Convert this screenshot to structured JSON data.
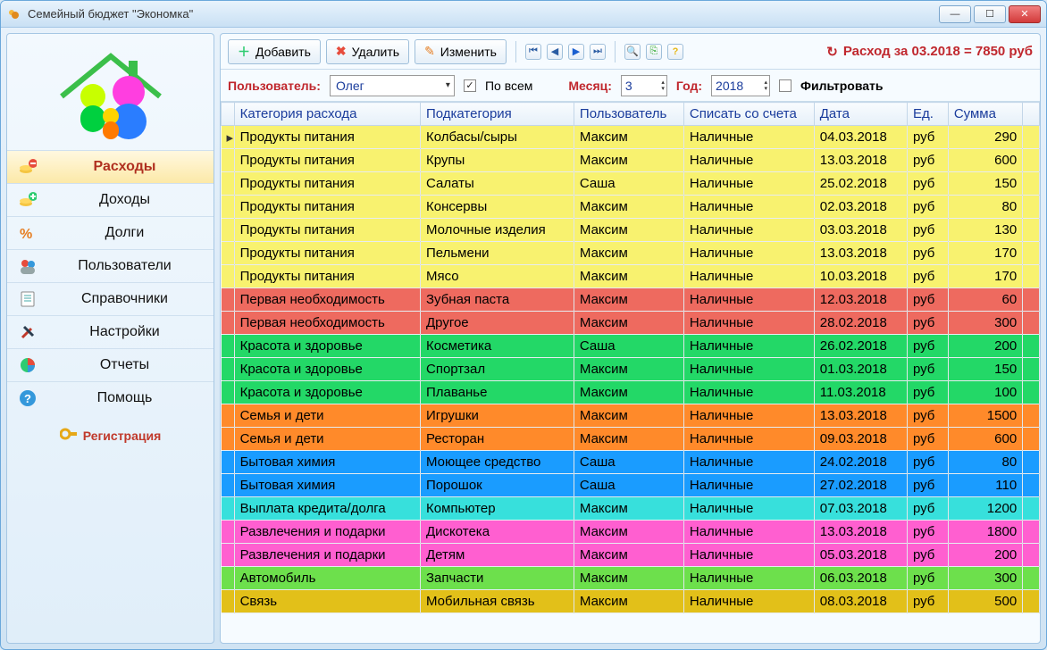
{
  "window": {
    "title": "Семейный бюджет \"Экономка\""
  },
  "sidebar": {
    "items": [
      {
        "label": "Расходы"
      },
      {
        "label": "Доходы"
      },
      {
        "label": "Долги"
      },
      {
        "label": "Пользователи"
      },
      {
        "label": "Справочники"
      },
      {
        "label": "Настройки"
      },
      {
        "label": "Отчеты"
      },
      {
        "label": "Помощь"
      }
    ],
    "register": "Регистрация"
  },
  "toolbar": {
    "add": "Добавить",
    "delete": "Удалить",
    "edit": "Изменить",
    "summary_prefix": "Расход за 03.2018 = ",
    "summary_value": "7850 руб"
  },
  "filters": {
    "user_label": "Пользователь:",
    "user_value": "Олег",
    "all_label": "По всем",
    "all_checked": true,
    "month_label": "Месяц:",
    "month_value": "3",
    "year_label": "Год:",
    "year_value": "2018",
    "filter_label": "Фильтровать",
    "filter_checked": false
  },
  "table": {
    "columns": [
      "Категория расхода",
      "Подкатегория",
      "Пользователь",
      "Списать со счета",
      "Дата",
      "Ед.",
      "Сумма"
    ],
    "rows": [
      {
        "color": "yellow",
        "marker": "▸",
        "cat": "Продукты питания",
        "sub": "Колбасы/сыры",
        "user": "Максим",
        "acct": "Наличные",
        "date": "04.03.2018",
        "unit": "руб",
        "sum": "290"
      },
      {
        "color": "yellow",
        "cat": "Продукты питания",
        "sub": "Крупы",
        "user": "Максим",
        "acct": "Наличные",
        "date": "13.03.2018",
        "unit": "руб",
        "sum": "600"
      },
      {
        "color": "yellow",
        "cat": "Продукты питания",
        "sub": "Салаты",
        "user": "Саша",
        "acct": "Наличные",
        "date": "25.02.2018",
        "unit": "руб",
        "sum": "150"
      },
      {
        "color": "yellow",
        "cat": "Продукты питания",
        "sub": "Консервы",
        "user": "Максим",
        "acct": "Наличные",
        "date": "02.03.2018",
        "unit": "руб",
        "sum": "80"
      },
      {
        "color": "yellow",
        "cat": "Продукты питания",
        "sub": "Молочные изделия",
        "user": "Максим",
        "acct": "Наличные",
        "date": "03.03.2018",
        "unit": "руб",
        "sum": "130"
      },
      {
        "color": "yellow",
        "cat": "Продукты питания",
        "sub": "Пельмени",
        "user": "Максим",
        "acct": "Наличные",
        "date": "13.03.2018",
        "unit": "руб",
        "sum": "170"
      },
      {
        "color": "yellow",
        "cat": "Продукты питания",
        "sub": "Мясо",
        "user": "Максим",
        "acct": "Наличные",
        "date": "10.03.2018",
        "unit": "руб",
        "sum": "170"
      },
      {
        "color": "red",
        "cat": "Первая необходимость",
        "sub": "Зубная паста",
        "user": "Максим",
        "acct": "Наличные",
        "date": "12.03.2018",
        "unit": "руб",
        "sum": "60"
      },
      {
        "color": "red",
        "cat": "Первая необходимость",
        "sub": "Другое",
        "user": "Максим",
        "acct": "Наличные",
        "date": "28.02.2018",
        "unit": "руб",
        "sum": "300"
      },
      {
        "color": "green",
        "cat": "Красота и здоровье",
        "sub": "Косметика",
        "user": "Саша",
        "acct": "Наличные",
        "date": "26.02.2018",
        "unit": "руб",
        "sum": "200"
      },
      {
        "color": "green",
        "cat": "Красота и здоровье",
        "sub": "Спортзал",
        "user": "Максим",
        "acct": "Наличные",
        "date": "01.03.2018",
        "unit": "руб",
        "sum": "150"
      },
      {
        "color": "green",
        "cat": "Красота и здоровье",
        "sub": "Плаванье",
        "user": "Максим",
        "acct": "Наличные",
        "date": "11.03.2018",
        "unit": "руб",
        "sum": "100"
      },
      {
        "color": "orange",
        "cat": "Семья и дети",
        "sub": "Игрушки",
        "user": "Максим",
        "acct": "Наличные",
        "date": "13.03.2018",
        "unit": "руб",
        "sum": "1500"
      },
      {
        "color": "orange",
        "cat": "Семья и дети",
        "sub": "Ресторан",
        "user": "Максим",
        "acct": "Наличные",
        "date": "09.03.2018",
        "unit": "руб",
        "sum": "600"
      },
      {
        "color": "blue",
        "cat": "Бытовая химия",
        "sub": "Моющее средство",
        "user": "Саша",
        "acct": "Наличные",
        "date": "24.02.2018",
        "unit": "руб",
        "sum": "80"
      },
      {
        "color": "blue",
        "cat": "Бытовая химия",
        "sub": "Порошок",
        "user": "Саша",
        "acct": "Наличные",
        "date": "27.02.2018",
        "unit": "руб",
        "sum": "110"
      },
      {
        "color": "cyan",
        "cat": "Выплата кредита/долга",
        "sub": "Компьютер",
        "user": "Максим",
        "acct": "Наличные",
        "date": "07.03.2018",
        "unit": "руб",
        "sum": "1200"
      },
      {
        "color": "pink",
        "cat": "Развлечения и подарки",
        "sub": "Дискотека",
        "user": "Максим",
        "acct": "Наличные",
        "date": "13.03.2018",
        "unit": "руб",
        "sum": "1800"
      },
      {
        "color": "pink",
        "cat": "Развлечения и подарки",
        "sub": "Детям",
        "user": "Максим",
        "acct": "Наличные",
        "date": "05.03.2018",
        "unit": "руб",
        "sum": "200"
      },
      {
        "color": "lime",
        "cat": "Автомобиль",
        "sub": "Запчасти",
        "user": "Максим",
        "acct": "Наличные",
        "date": "06.03.2018",
        "unit": "руб",
        "sum": "300"
      },
      {
        "color": "gold",
        "cat": "Связь",
        "sub": "Мобильная связь",
        "user": "Максим",
        "acct": "Наличные",
        "date": "08.03.2018",
        "unit": "руб",
        "sum": "500"
      }
    ]
  }
}
